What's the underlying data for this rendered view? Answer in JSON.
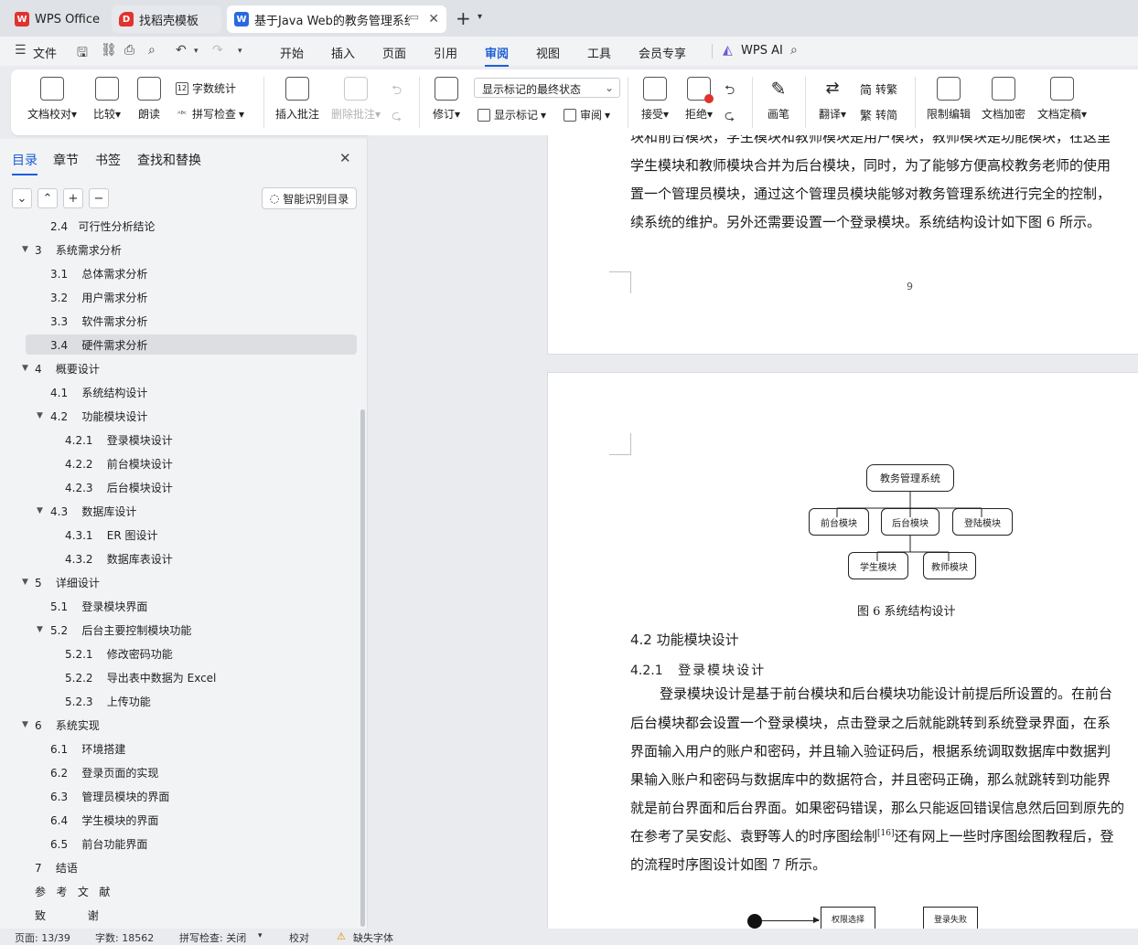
{
  "tabs": [
    {
      "label": "WPS Office",
      "icon": "wps-logo-icon"
    },
    {
      "label": "找稻壳模板",
      "icon": "docer-icon"
    },
    {
      "label": "基于Java Web的教务管理系统",
      "icon": "writer-icon"
    }
  ],
  "menu": {
    "file": "文件",
    "items": [
      "开始",
      "插入",
      "页面",
      "引用",
      "审阅",
      "视图",
      "工具",
      "会员专享"
    ],
    "active": "审阅",
    "wps_ai": "WPS AI"
  },
  "ribbon": {
    "doc_proofread": "文档校对",
    "compare": "比较",
    "read_aloud": "朗读",
    "word_count": "字数统计",
    "spell_check": "拼写检查",
    "insert_comment": "插入批注",
    "delete_comment": "删除批注",
    "revise": "修订",
    "markup_state": "显示标记的最终状态",
    "show_markup": "显示标记",
    "review": "审阅",
    "accept": "接受",
    "reject": "拒绝",
    "pen": "画笔",
    "translate": "翻译",
    "to_traditional": "转繁",
    "to_simplified": "转简",
    "restrict_edit": "限制编辑",
    "doc_encrypt": "文档加密",
    "doc_finalize": "文档定稿"
  },
  "sidebar": {
    "tabs": [
      "目录",
      "章节",
      "书签",
      "查找和替换"
    ],
    "smart_btn": "智能识别目录",
    "toc": [
      {
        "label": "2.4   可行性分析结论",
        "level": 2
      },
      {
        "label": "3    系统需求分析",
        "level": 1
      },
      {
        "label": "3.1    总体需求分析",
        "level": 2
      },
      {
        "label": "3.2    用户需求分析",
        "level": 2
      },
      {
        "label": "3.3    软件需求分析",
        "level": 2
      },
      {
        "label": "3.4    硬件需求分析",
        "level": 2
      },
      {
        "label": "4    概要设计",
        "level": 1
      },
      {
        "label": "4.1    系统结构设计",
        "level": 2
      },
      {
        "label": "4.2    功能模块设计",
        "level": 2
      },
      {
        "label": "4.2.1    登录模块设计",
        "level": 3
      },
      {
        "label": "4.2.2    前台模块设计",
        "level": 3
      },
      {
        "label": "4.2.3    后台模块设计",
        "level": 3
      },
      {
        "label": "4.3    数据库设计",
        "level": 2
      },
      {
        "label": "4.3.1    ER 图设计",
        "level": 3
      },
      {
        "label": "4.3.2    数据库表设计",
        "level": 3
      },
      {
        "label": "5    详细设计",
        "level": 1
      },
      {
        "label": "5.1    登录模块界面",
        "level": 2
      },
      {
        "label": "5.2    后台主要控制模块功能",
        "level": 2
      },
      {
        "label": "5.2.1    修改密码功能",
        "level": 3
      },
      {
        "label": "5.2.2    导出表中数据为 Excel",
        "level": 3
      },
      {
        "label": "5.2.3    上传功能",
        "level": 3
      },
      {
        "label": "6    系统实现",
        "level": 1
      },
      {
        "label": "6.1    环境搭建",
        "level": 2
      },
      {
        "label": "6.2    登录页面的实现",
        "level": 2
      },
      {
        "label": "6.3    管理员模块的界面",
        "level": 2
      },
      {
        "label": "6.4    学生模块的界面",
        "level": 2
      },
      {
        "label": "6.5    前台功能界面",
        "level": 2
      },
      {
        "label": "7    结语",
        "level": 1
      },
      {
        "label": "参   考   文   献",
        "level": 1
      },
      {
        "label": "致            谢",
        "level": 1
      }
    ],
    "selected_index": 5
  },
  "document": {
    "page1_lines": [
      "块和前台模块，学生模块和教师模块是用户模块，教师模块是功能模块，在这里",
      "学生模块和教师模块合并为后台模块，同时，为了能够方便高校教务老师的使用",
      "置一个管理员模块，通过这个管理员模块能够对教务管理系统进行完全的控制，",
      "续系统的维护。另外还需要设置一个登录模块。系统结构设计如下图 6 所示。"
    ],
    "page_number": "9",
    "diagram": {
      "root": "教务管理系统",
      "level2": [
        "前台模块",
        "后台模块",
        "登陆模块"
      ],
      "level3": [
        "学生模块",
        "教师模块"
      ],
      "caption": "图 6 系统结构设计"
    },
    "heading_42": "4.2   功能模块设计",
    "heading_421_num": "4.2.1",
    "heading_421_text": "登录模块设计",
    "para_lines": [
      "登录模块设计是基于前台模块和后台模块功能设计前提后所设置的。在前台",
      "后台模块都会设置一个登录模块，点击登录之后就能跳转到系统登录界面，在系",
      "界面输入用户的账户和密码，并且输入验证码后，根据系统调取数据库中数据判",
      "果输入账户和密码与数据库中的数据符合，并且密码正确，那么就跳转到功能界",
      "就是前台界面和后台界面。如果密码错误，那么只能返回错误信息然后回到原先的",
      "在参考了吴安彪、袁野等人的时序图绘制",
      "的流程时序图设计如图 7 所示。"
    ],
    "citation": "[16]",
    "para_line6_tail": "还有网上一些时序图绘图教程后，登",
    "seq_boxes": [
      "权限选择",
      "登录失败"
    ]
  },
  "status": {
    "page": "页面: 13/39",
    "words": "字数: 18562",
    "spell": "拼写检查: 关闭",
    "proof": "校对",
    "missing_font": "缺失字体"
  },
  "colors": {
    "accent": "#1d5fd6",
    "wps_red": "#e0322f"
  }
}
